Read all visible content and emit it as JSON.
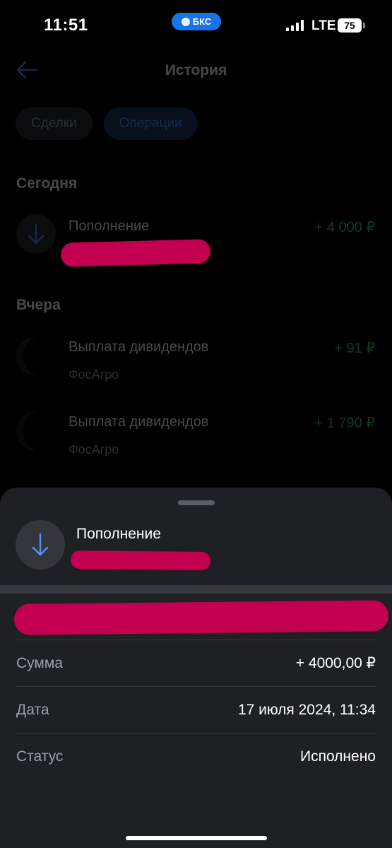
{
  "status_bar": {
    "time": "11:51",
    "app_pill": "БКС",
    "network": "LTE",
    "battery": "75"
  },
  "header": {
    "title": "История",
    "back_icon": "arrow-left-icon"
  },
  "tabs": [
    {
      "label": "Сделки",
      "active": false
    },
    {
      "label": "Операции",
      "active": true
    }
  ],
  "sections": {
    "today": {
      "title": "Сегодня",
      "items": [
        {
          "title": "Пополнение",
          "amount": "+ 4 000 ₽",
          "icon": "arrow-down-icon"
        }
      ]
    },
    "yesterday": {
      "title": "Вчера",
      "items": [
        {
          "title": "Выплата дивидендов",
          "subtitle": "ФосАгро",
          "amount": "+ 91 ₽"
        },
        {
          "title": "Выплата дивидендов",
          "subtitle": "ФосАгро",
          "amount": "+ 1 790 ₽"
        }
      ]
    }
  },
  "sheet": {
    "title": "Пополнение",
    "icon": "arrow-down-icon",
    "details": [
      {
        "label": "Сумма",
        "value": "+ 4000,00 ₽"
      },
      {
        "label": "Дата",
        "value": "17 июля 2024, 11:34"
      },
      {
        "label": "Статус",
        "value": "Исполнено"
      }
    ]
  },
  "colors": {
    "accent_blue": "#4f93ff",
    "positive_green": "#3ed07a",
    "redaction": "#c2004f",
    "sheet_bg": "#1e2024"
  }
}
